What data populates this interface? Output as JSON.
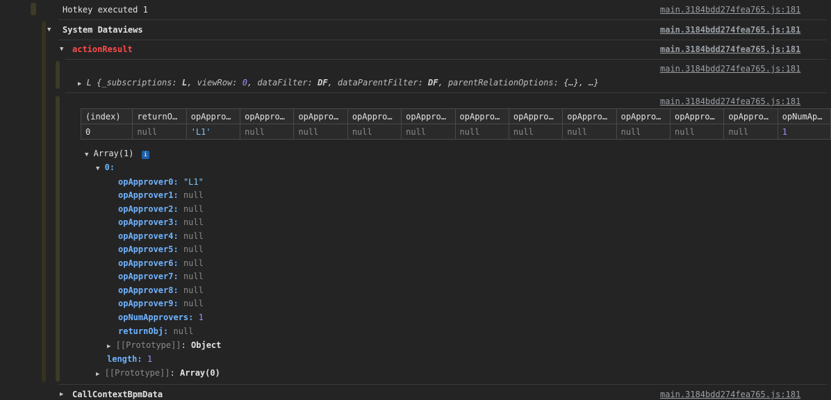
{
  "source_link": "main.3184bdd274fea765.js:181",
  "lines": {
    "hotkey": "Hotkey executed 1",
    "system_dataviews": "System Dataviews",
    "action_result": "actionResult",
    "call_context": "CallContextBpmData"
  },
  "object_preview": {
    "class_name": "L",
    "open": "{",
    "props": [
      {
        "key": "_subscriptions",
        "value": "L"
      },
      {
        "key": "viewRow",
        "value": "0"
      },
      {
        "key": "dataFilter",
        "value": "DF"
      },
      {
        "key": "dataParentFilter",
        "value": "DF"
      },
      {
        "key": "parentRelationOptions",
        "value": "{…}"
      }
    ],
    "tail": ", …}"
  },
  "table": {
    "headers": [
      "(index)",
      "returnO…",
      "opAppro…",
      "opAppro…",
      "opAppro…",
      "opAppro…",
      "opAppro…",
      "opAppro…",
      "opAppro…",
      "opAppro…",
      "opAppro…",
      "opAppro…",
      "opAppro…",
      "opNumAp…"
    ],
    "row": [
      "0",
      "null",
      "'L1'",
      "null",
      "null",
      "null",
      "null",
      "null",
      "null",
      "null",
      "null",
      "null",
      "null",
      "1"
    ]
  },
  "array_tree": {
    "label": "Array(1)",
    "badge": "i",
    "index_label": "0:",
    "entries": [
      {
        "key": "opApprover0:",
        "value": "\"L1\"",
        "kind": "str"
      },
      {
        "key": "opApprover1:",
        "value": "null",
        "kind": "null"
      },
      {
        "key": "opApprover2:",
        "value": "null",
        "kind": "null"
      },
      {
        "key": "opApprover3:",
        "value": "null",
        "kind": "null"
      },
      {
        "key": "opApprover4:",
        "value": "null",
        "kind": "null"
      },
      {
        "key": "opApprover5:",
        "value": "null",
        "kind": "null"
      },
      {
        "key": "opApprover6:",
        "value": "null",
        "kind": "null"
      },
      {
        "key": "opApprover7:",
        "value": "null",
        "kind": "null"
      },
      {
        "key": "opApprover8:",
        "value": "null",
        "kind": "null"
      },
      {
        "key": "opApprover9:",
        "value": "null",
        "kind": "null"
      },
      {
        "key": "opNumApprovers:",
        "value": "1",
        "kind": "num"
      },
      {
        "key": "returnObj:",
        "value": "null",
        "kind": "null"
      }
    ],
    "prototype_object": {
      "key": "[[Prototype]]",
      "value": "Object"
    },
    "length": {
      "key": "length:",
      "value": "1"
    },
    "prototype_array": {
      "key": "[[Prototype]]",
      "value": "Array(0)"
    }
  }
}
